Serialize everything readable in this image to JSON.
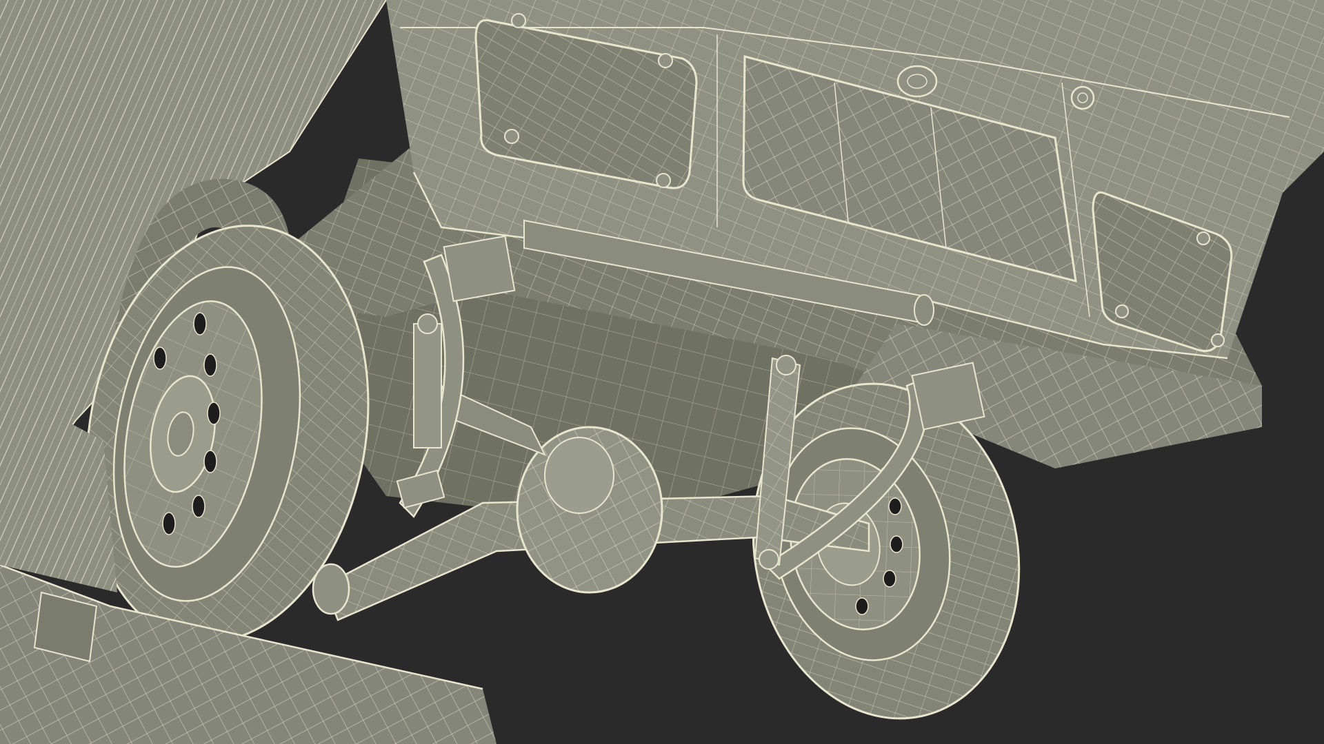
{
  "scene": {
    "subject": "wireframe-render-underside-rear-of-utility-vehicle",
    "colors": {
      "background": "#2a2a2a",
      "body_shade": "#8a8c7c",
      "body_dark": "#6c6e60",
      "body_light": "#a3a595",
      "wire": "#e8e6cf",
      "tire": "#858878",
      "hole": "#1d1d1d"
    }
  }
}
